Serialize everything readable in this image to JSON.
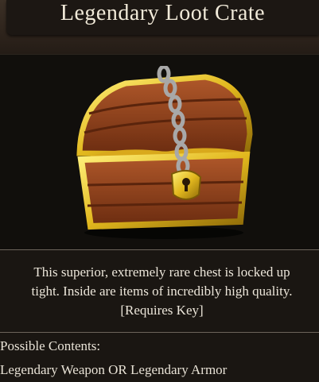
{
  "item": {
    "title": "Legendary Loot Crate",
    "description_line1": "This superior, extremely rare chest is locked up",
    "description_line2": "tight. Inside are items of incredibly high quality.",
    "description_line3": "[Requires Key]",
    "contents_label": "Possible Contents:",
    "contents_value": "Legendary Weapon OR Legendary Armor"
  },
  "colors": {
    "background": "#1a1612",
    "title_bar": "#1c1713",
    "text": "#ece6da",
    "chest_wood": "#8a3e17",
    "chest_gold": "#e2b81e"
  },
  "icons": {
    "item_image": "treasure-chest-icon"
  }
}
